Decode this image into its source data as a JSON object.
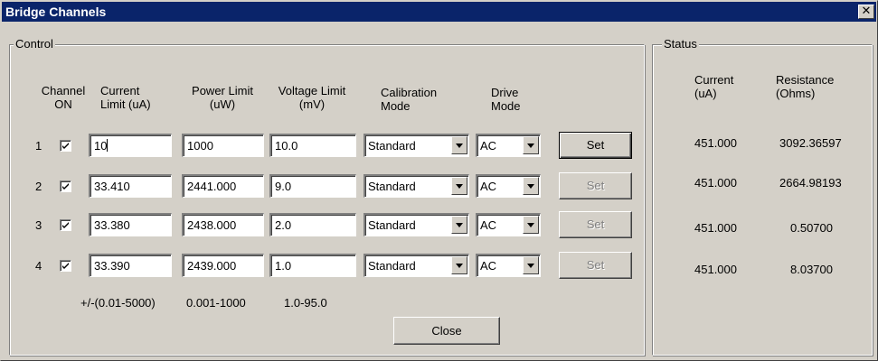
{
  "window": {
    "title": "Bridge Channels",
    "close_glyph": "✕"
  },
  "control": {
    "label": "Control",
    "headers": {
      "channel_line1": "Channel",
      "channel_line2": "ON",
      "current_line1": "Current",
      "current_line2": "Limit (uA)",
      "power_line1": "Power Limit",
      "power_line2": "(uW)",
      "voltage_line1": "Voltage Limit",
      "voltage_line2": "(mV)",
      "calibration_line1": "Calibration",
      "calibration_line2": "Mode",
      "drive_line1": "Drive",
      "drive_line2": "Mode"
    },
    "rows": [
      {
        "channel": "1",
        "checked": true,
        "current": "10",
        "power": "1000",
        "voltage": "10.0",
        "calibration": "Standard",
        "drive": "AC",
        "set": "Set",
        "set_enabled": true
      },
      {
        "channel": "2",
        "checked": true,
        "current": "33.410",
        "power": "2441.000",
        "voltage": "9.0",
        "calibration": "Standard",
        "drive": "AC",
        "set": "Set",
        "set_enabled": false
      },
      {
        "channel": "3",
        "checked": true,
        "current": "33.380",
        "power": "2438.000",
        "voltage": "2.0",
        "calibration": "Standard",
        "drive": "AC",
        "set": "Set",
        "set_enabled": false
      },
      {
        "channel": "4",
        "checked": true,
        "current": "33.390",
        "power": "2439.000",
        "voltage": "1.0",
        "calibration": "Standard",
        "drive": "AC",
        "set": "Set",
        "set_enabled": false
      }
    ],
    "ranges": {
      "current": "+/-(0.01-5000)",
      "power": "0.001-1000",
      "voltage": "1.0-95.0"
    },
    "close_label": "Close"
  },
  "status": {
    "label": "Status",
    "headers": {
      "current_line1": "Current",
      "current_line2": "(uA)",
      "resistance_line1": "Resistance",
      "resistance_line2": "(Ohms)"
    },
    "rows": [
      {
        "current": "451.000",
        "resistance": "3092.36597"
      },
      {
        "current": "451.000",
        "resistance": "2664.98193"
      },
      {
        "current": "451.000",
        "resistance": "0.50700"
      },
      {
        "current": "451.000",
        "resistance": "8.03700"
      }
    ]
  }
}
